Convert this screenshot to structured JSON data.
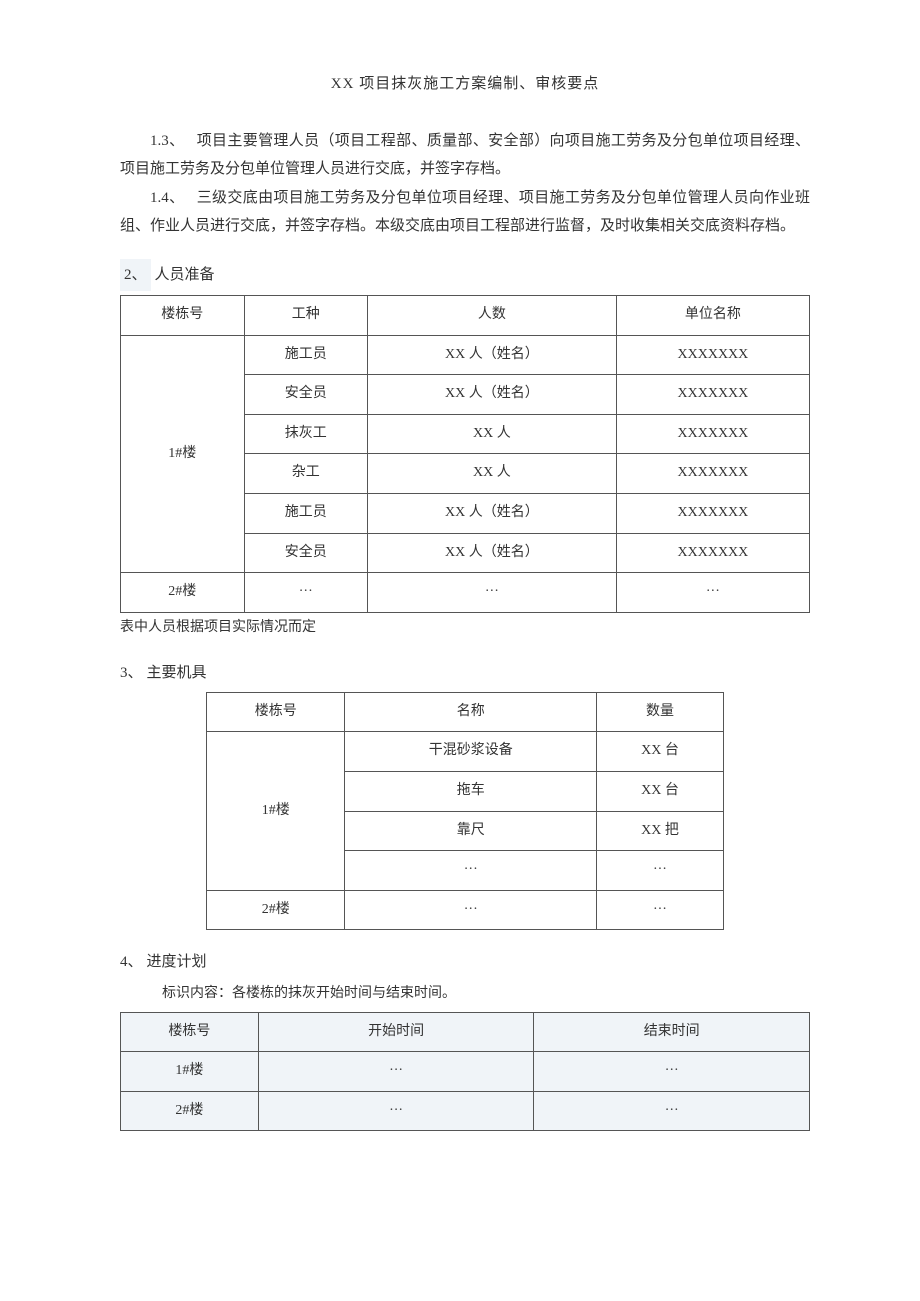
{
  "title": "XX 项目抹灰施工方案编制、审核要点",
  "paragraphs": {
    "p13_num": "1.3、",
    "p13": "项目主要管理人员（项目工程部、质量部、安全部）向项目施工劳务及分包单位项目经理、项目施工劳务及分包单位管理人员进行交底，并签字存档。",
    "p14_num": "1.4、",
    "p14": "三级交底由项目施工劳务及分包单位项目经理、项目施工劳务及分包单位管理人员向作业班组、作业人员进行交底，并签字存档。本级交底由项目工程部进行监督，及时收集相关交底资料存档。"
  },
  "section2": {
    "num": "2、",
    "title": "人员准备",
    "headers": [
      "楼栋号",
      "工种",
      "人数",
      "单位名称"
    ],
    "rows": [
      {
        "building": "1#楼",
        "type": "施工员",
        "count": "XX 人（姓名）",
        "unit": "XXXXXXX"
      },
      {
        "building": "",
        "type": "安全员",
        "count": "XX 人（姓名）",
        "unit": "XXXXXXX"
      },
      {
        "building": "",
        "type": "抹灰工",
        "count": "XX 人",
        "unit": "XXXXXXX"
      },
      {
        "building": "",
        "type": "杂工",
        "count": "XX 人",
        "unit": "XXXXXXX"
      },
      {
        "building": "",
        "type": "施工员",
        "count": "XX 人（姓名）",
        "unit": "XXXXXXX"
      },
      {
        "building": "",
        "type": "安全员",
        "count": "XX 人（姓名）",
        "unit": "XXXXXXX"
      },
      {
        "building": "2#楼",
        "type": "···",
        "count": "···",
        "unit": "···"
      }
    ],
    "note": "表中人员根据项目实际情况而定"
  },
  "section3": {
    "num": "3、",
    "title": "主要机具",
    "headers": [
      "楼栋号",
      "名称",
      "数量"
    ],
    "rows": [
      {
        "building": "1#楼",
        "name": "干混砂浆设备",
        "qty": "XX 台"
      },
      {
        "building": "",
        "name": "拖车",
        "qty": "XX 台"
      },
      {
        "building": "",
        "name": "靠尺",
        "qty": "XX 把"
      },
      {
        "building": "",
        "name": "···",
        "qty": "···"
      },
      {
        "building": "2#楼",
        "name": "···",
        "qty": "···"
      }
    ]
  },
  "section4": {
    "num": "4、",
    "title": "进度计划",
    "subnote": "标识内容：各楼栋的抹灰开始时间与结束时间。",
    "headers": [
      "楼栋号",
      "开始时间",
      "结束时间"
    ],
    "rows": [
      {
        "building": "1#楼",
        "start": "···",
        "end": "···"
      },
      {
        "building": "2#楼",
        "start": "···",
        "end": "···"
      }
    ]
  }
}
